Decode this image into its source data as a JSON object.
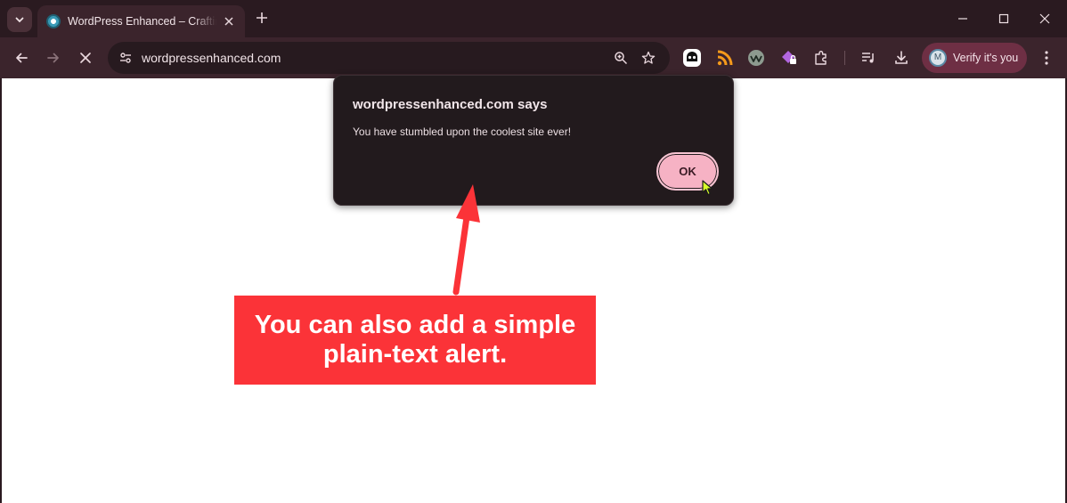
{
  "browser": {
    "tab": {
      "title": "WordPress Enhanced – Crafting"
    },
    "omnibox": {
      "url": "wordpressenhanced.com"
    },
    "profile": {
      "avatar_letter": "M",
      "label": "Verify it's you"
    },
    "icons": {
      "tab_search": "chevron-down-icon",
      "tab_close": "close-icon",
      "new_tab": "plus-icon",
      "back": "arrow-left-icon",
      "forward": "arrow-right-icon",
      "stop": "close-icon",
      "site_info": "tune-icon",
      "zoom": "zoom-in-icon",
      "bookmark": "star-outline-icon",
      "extensions": [
        "ghost-extension-icon",
        "rss-icon",
        "wave-extension-icon",
        "diamond-lock-icon",
        "puzzle-icon",
        "media-queue-icon",
        "download-icon"
      ],
      "menu": "kebab-menu-icon"
    }
  },
  "dialog": {
    "title": "wordpressenhanced.com says",
    "message": "You have stumbled upon the coolest site ever!",
    "ok_label": "OK"
  },
  "annotation": {
    "text": "You can also add a simple plain-text alert."
  },
  "colors": {
    "titlebar": "#2a1a20",
    "toolbar": "#3b242c",
    "dialog_bg": "#221a1d",
    "ok_button": "#f6b2c4",
    "callout": "#fb3338",
    "profile_chip": "#6e2f44"
  }
}
